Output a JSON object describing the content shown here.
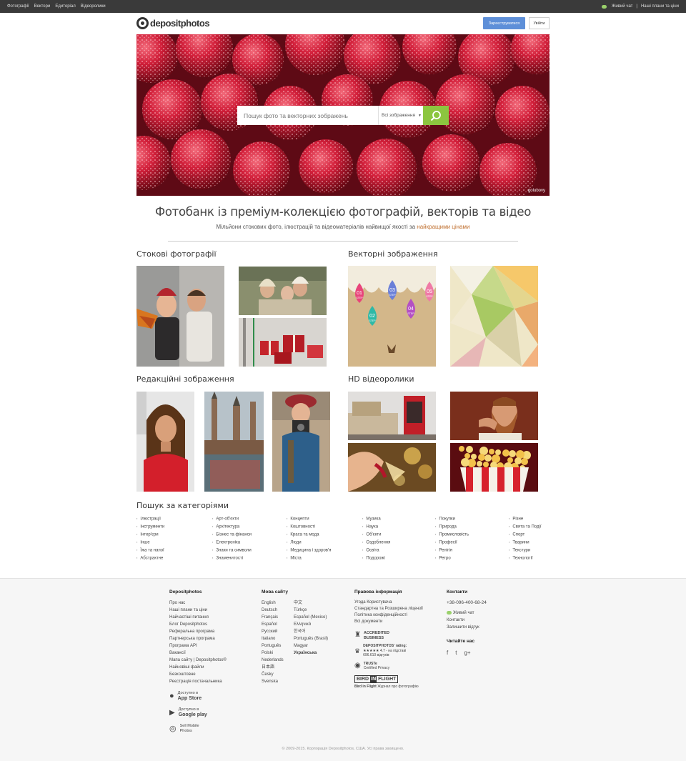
{
  "topbar": {
    "nav": [
      "Фотографії",
      "Вектори",
      "Едиторіал",
      "Відеоролики"
    ],
    "live_chat": "Живий чат",
    "separator": "|",
    "plans": "Наші плани та ціни"
  },
  "header": {
    "logo_text": "depositphotos",
    "register": "Зареєструватися",
    "login": "Увійти"
  },
  "hero": {
    "search_placeholder": "Пошук фото та векторних зображень",
    "search_type": "Всі зображення",
    "credit": "golubovy"
  },
  "headline": "Фотобанк із преміум-колекцією фотографій, векторів та відео",
  "subline_parts": [
    "Мільйони стокових фото, ілюстрацій та відеоматеріалів найвищої якості за ",
    "найкращими цінами"
  ],
  "sections": {
    "stock_photos": "Стокові фотографії",
    "vectors": "Векторні зображення",
    "editorial": "Редакційні зображення",
    "hd_video": "HD відеоролики"
  },
  "vector_drops": [
    "01",
    "02",
    "03",
    "04",
    "05"
  ],
  "vector_drop_labels": [
    "STEP",
    "STEP",
    "STEP",
    "STEP",
    "STEP"
  ],
  "categories_title": "Пошук за категоріями",
  "categories": [
    [
      "Ілюстрації",
      "Інструменти",
      "Інтер'єри",
      "Інше",
      "Їжа та напої",
      "Абстрактне"
    ],
    [
      "Арт-об'єкти",
      "Архітектура",
      "Бізнес та фінанси",
      "Електроніка",
      "Знаки та символи",
      "Знаменитості"
    ],
    [
      "Концепти",
      "Коштовності",
      "Краса та мода",
      "Люди",
      "Медицина і здоров'я",
      "Міста"
    ],
    [
      "Музика",
      "Наука",
      "Об'єкти",
      "Оздоблення",
      "Освіта",
      "Подорожі"
    ],
    [
      "Покупки",
      "Природа",
      "Промисловість",
      "Професії",
      "Релігія",
      "Ретро"
    ],
    [
      "Різне",
      "Свята та Події",
      "Спорт",
      "Тварини",
      "Текстури",
      "Технології"
    ]
  ],
  "footer": {
    "col1": {
      "title": "Depositphotos",
      "links": [
        "Про нас",
        "Наші плани та ціни",
        "Найчастіші питання",
        "Блог Depositphotos",
        "Реферальна програма",
        "Партнерська програма",
        "Програма API",
        "Вакансії",
        "Мапа сайту | Depositphotos®",
        "Найновіші файли",
        "Безкоштовне",
        "Реєстрація постачальника"
      ],
      "app_store_small": "Доступно в",
      "app_store": "App Store",
      "google_small": "Доступно в",
      "google": "Google play",
      "sell_line1": "Sell Mobile",
      "sell_line2": "Photos"
    },
    "col2": {
      "title": "Мова сайту",
      "langs_left": [
        "English",
        "Deutsch",
        "Français",
        "Español",
        "Русский",
        "Italiano",
        "Português",
        "Polski",
        "Nederlands",
        "日本語",
        "Česky",
        "Svenska"
      ],
      "langs_right": [
        "中文",
        "Türkçe",
        "Español (Mexico)",
        "Ελληνικά",
        "한국어",
        "Português (Brasil)",
        "Magyar",
        "Українська"
      ]
    },
    "col3": {
      "title": "Правова інформація",
      "links": [
        "Угода Користувача",
        "Стандартна та Розширена ліцензії",
        "Політика конфіденційності",
        "Всі документи"
      ],
      "bbb_line1": "ACCREDITED",
      "bbb_line2": "BUSINESS",
      "rating_line1": "DEPOSITPHOTOS' rating:",
      "rating_stars": "★★★★★",
      "rating_line2": "4.7 - на підставі",
      "rating_line3": "696.610 відгуків",
      "truste_line1": "TRUSTe",
      "truste_line2": "Certified Privacy",
      "bif_word1": "BIRD",
      "bif_word2": "IN",
      "bif_word3": "FLIGHT",
      "bif_text1": "Bird in Flight",
      "bif_text2": "Журнал про фотографію"
    },
    "col4": {
      "title": "Контакти",
      "phone": "+38-096-400-68-24",
      "live_chat": "Живий чат",
      "contacts": "Контакти",
      "feedback": "Залишити відгук",
      "read_us": "Читайте нас",
      "social": [
        "f",
        "t",
        "g+"
      ]
    },
    "copyright": "© 2009-2015. Корпорація Depositphotos, США. Усі права захищено."
  },
  "colors": {
    "topbar": "#3a3a3a",
    "register": "#5e8fd8",
    "search_button": "#8cc63f",
    "footer_bg": "#f6f6f6"
  }
}
